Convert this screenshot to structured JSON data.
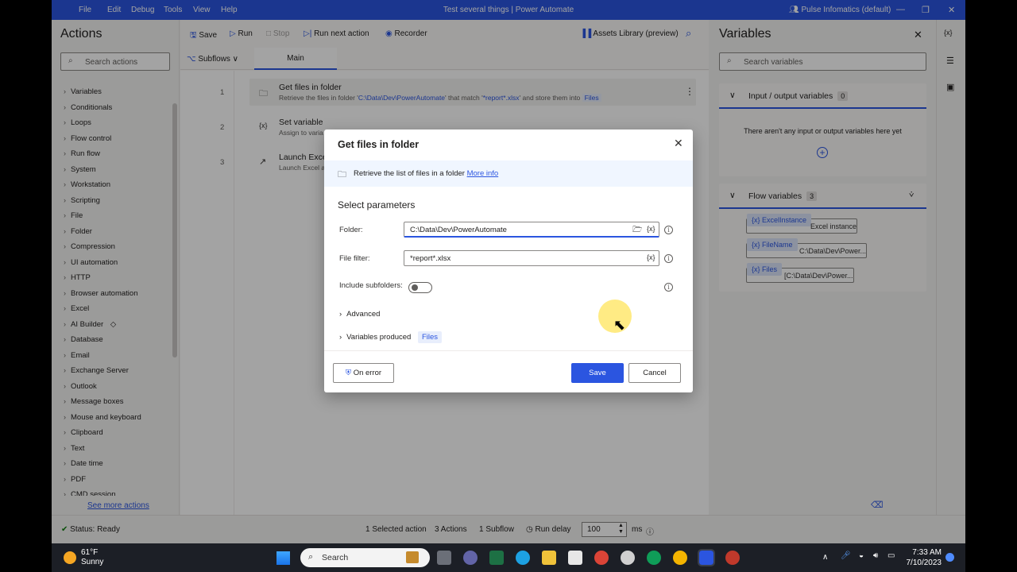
{
  "window": {
    "menu": [
      "File",
      "Edit",
      "Debug",
      "Tools",
      "View",
      "Help"
    ],
    "title": "Test several things | Power Automate",
    "account": "Pulse Infomatics (default)"
  },
  "actions": {
    "title": "Actions",
    "search_placeholder": "Search actions",
    "items": [
      "Variables",
      "Conditionals",
      "Loops",
      "Flow control",
      "Run flow",
      "System",
      "Workstation",
      "Scripting",
      "File",
      "Folder",
      "Compression",
      "UI automation",
      "HTTP",
      "Browser automation",
      "Excel",
      "AI Builder",
      "Database",
      "Email",
      "Exchange Server",
      "Outlook",
      "Message boxes",
      "Mouse and keyboard",
      "Clipboard",
      "Text",
      "Date time",
      "PDF",
      "CMD session"
    ],
    "see_more": "See more actions"
  },
  "toolbar": {
    "save": "Save",
    "run": "Run",
    "stop": "Stop",
    "run_next": "Run next action",
    "recorder": "Recorder",
    "assets": "Assets Library (preview)"
  },
  "tabs": {
    "subflows": "Subflows",
    "main": "Main"
  },
  "steps": [
    {
      "num": "1",
      "title": "Get files in folder",
      "desc_pre": "Retrieve the files in folder '",
      "desc_folder": "C:\\Data\\Dev\\PowerAutomate",
      "desc_mid": "' that match '",
      "desc_filter": "*report*.xlsx",
      "desc_post": "' and store them into",
      "desc_var": "Files"
    },
    {
      "num": "2",
      "title": "Set variable",
      "desc": "Assign to varia"
    },
    {
      "num": "3",
      "title": "Launch Exce",
      "desc": "Launch Excel a"
    }
  ],
  "variables": {
    "title": "Variables",
    "search_placeholder": "Search variables",
    "io_title": "Input / output variables",
    "io_count": "0",
    "io_empty": "There aren't any input or output variables here yet",
    "flow_title": "Flow variables",
    "flow_count": "3",
    "flow_vars": [
      {
        "name": "ExcelInstance",
        "value": "Excel instance"
      },
      {
        "name": "FileName",
        "value": "C:\\Data\\Dev\\Power..."
      },
      {
        "name": "Files",
        "value": "[C:\\Data\\Dev\\Power..."
      }
    ]
  },
  "status": {
    "ready": "Status: Ready",
    "selected": "1 Selected action",
    "actions": "3 Actions",
    "subflow": "1 Subflow",
    "run_delay_label": "Run delay",
    "run_delay_value": "100",
    "ms": "ms"
  },
  "dialog": {
    "title": "Get files in folder",
    "info": "Retrieve the list of files in a folder",
    "more_info": "More info",
    "section": "Select parameters",
    "folder_label": "Folder:",
    "folder_value": "C:\\Data\\Dev\\PowerAutomate",
    "filter_label": "File filter:",
    "filter_value": "*report*.xlsx",
    "subfolders_label": "Include subfolders:",
    "subfolders_on": false,
    "advanced": "Advanced",
    "variables_produced": "Variables produced",
    "produced_var": "Files",
    "on_error": "On error",
    "save": "Save",
    "cancel": "Cancel"
  },
  "taskbar": {
    "temp": "61°F",
    "weather": "Sunny",
    "search": "Search",
    "time": "7:33 AM",
    "date": "7/10/2023"
  },
  "colors": {
    "accent": "#2b55e0",
    "titlebar": "#2b55e0",
    "taskbar": "#1c1f26"
  }
}
